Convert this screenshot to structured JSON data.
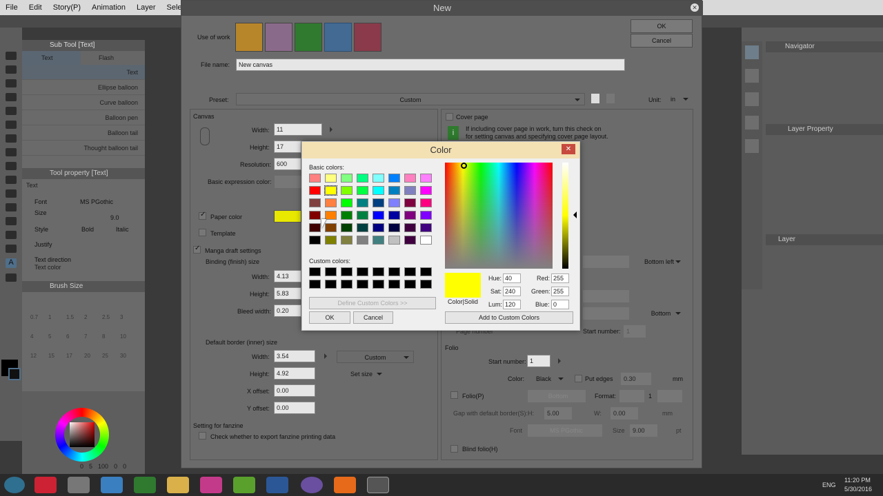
{
  "menubar": [
    "File",
    "Edit",
    "Story(P)",
    "Animation",
    "Layer",
    "Selection"
  ],
  "subtool": {
    "title": "Sub Tool [Text]",
    "tabs": [
      "Text",
      "Flash"
    ],
    "items": [
      "Text",
      "Ellipse balloon",
      "Curve balloon",
      "Balloon pen",
      "Balloon tail",
      "Thought balloon tail"
    ],
    "tool_property_title": "Tool property [Text]",
    "tool_label": "Text",
    "font_label": "Font",
    "font_value": "MS PGothic",
    "size_label": "Size",
    "size_value": "9.0",
    "style_label": "Style",
    "bold": "Bold",
    "italic": "Italic",
    "justify": "Justify",
    "text_direction": "Text direction",
    "text_color": "Text color",
    "brush_size_title": "Brush Size",
    "brush_sizes_row1": [
      "0.7",
      "1",
      "1.5",
      "2",
      "2.5",
      "3"
    ],
    "brush_sizes_row2": [
      "4",
      "5",
      "6",
      "7",
      "8",
      "10"
    ],
    "brush_sizes_row3": [
      "12",
      "15",
      "17",
      "20",
      "25",
      "30"
    ],
    "color_bottom": [
      "0",
      "5",
      "100",
      "0",
      "0"
    ]
  },
  "right_panel": {
    "navigator": "Navigator",
    "layer_property": "Layer Property",
    "layer": "Layer"
  },
  "new_dialog": {
    "title": "New",
    "ok": "OK",
    "cancel": "Cancel",
    "use_of_work": "Use of work",
    "file_name_label": "File name:",
    "file_name_value": "New canvas",
    "preset_label": "Preset:",
    "preset_value": "Custom",
    "unit_label": "Unit:",
    "unit_value": "in",
    "canvas_label": "Canvas",
    "width_label": "Width:",
    "width_value": "11",
    "height_label": "Height:",
    "height_value": "17",
    "resolution_label": "Resolution:",
    "resolution_value": "600",
    "basic_expression_color": "Basic expression color:",
    "paper_color": "Paper color",
    "template": "Template",
    "manga_draft": "Manga draft settings",
    "binding_size": "Binding (finish) size",
    "b_width_value": "4.13",
    "b_height_value": "5.83",
    "bleed_width_label": "Bleed width:",
    "bleed_width_value": "0.20",
    "default_border": "Default border (inner) size",
    "d_width_value": "3.54",
    "d_height_value": "4.92",
    "d_custom": "Custom",
    "set_size": "Set size",
    "x_offset_label": "X offset:",
    "x_offset_value": "0.00",
    "y_offset_label": "Y offset:",
    "y_offset_value": "0.00",
    "fanzine_title": "Setting for fanzine",
    "fanzine_check": "Check whether to export fanzine printing data",
    "cover_page": "Cover page",
    "cover_info_1": "If including cover page in work, turn this check on",
    "cover_info_2": "for setting canvas and specifying cover page layout.",
    "bottom_left": "Bottom left",
    "bottom": "Bottom",
    "page_number": "Page number",
    "start_number_label": "Start number:",
    "start_number_value": "1",
    "folio": "Folio",
    "folio_start_label": "Start number:",
    "folio_start_value": "1",
    "color_label": "Color:",
    "color_value": "Black",
    "put_edges": "Put edges",
    "put_edges_value": "0.30",
    "mm": "mm",
    "folio_p": "Folio(P)",
    "folio_bottom": "Bottom",
    "format_label": "Format:",
    "format_value": "1",
    "gap_label": "Gap with default border(S):",
    "gap_h": "H:",
    "gap_h_value": "5.00",
    "gap_w": "W:",
    "gap_w_value": "0.00",
    "font_label": "Font",
    "font_value": "MS PGothic",
    "size_label": "Size",
    "size_value": "9.00",
    "pt": "pt",
    "blind_folio": "Blind folio(H)"
  },
  "color_dialog": {
    "title": "Color",
    "basic_colors": "Basic colors:",
    "custom_colors": "Custom colors:",
    "define_custom": "Define Custom Colors >>",
    "ok": "OK",
    "cancel": "Cancel",
    "color_solid": "Color|Solid",
    "hue_label": "Hue:",
    "hue": "40",
    "sat_label": "Sat:",
    "sat": "240",
    "lum_label": "Lum:",
    "lum": "120",
    "red_label": "Red:",
    "red": "255",
    "green_label": "Green:",
    "green": "255",
    "blue_label": "Blue:",
    "blue": "0",
    "add_custom": "Add to Custom Colors",
    "selected_color": "#ffff00",
    "basic_swatches": [
      "#ff8080",
      "#ffff80",
      "#80ff80",
      "#00ff80",
      "#80ffff",
      "#0080ff",
      "#ff80c0",
      "#ff80ff",
      "#ff0000",
      "#ffff00",
      "#80ff00",
      "#00ff40",
      "#00ffff",
      "#0080c0",
      "#8080c0",
      "#ff00ff",
      "#804040",
      "#ff8040",
      "#00ff00",
      "#008080",
      "#004080",
      "#8080ff",
      "#800040",
      "#ff0080",
      "#800000",
      "#ff8000",
      "#008000",
      "#008040",
      "#0000ff",
      "#0000a0",
      "#800080",
      "#8000ff",
      "#400000",
      "#804000",
      "#004000",
      "#004040",
      "#000080",
      "#000040",
      "#400040",
      "#400080",
      "#000000",
      "#808000",
      "#808040",
      "#808080",
      "#408080",
      "#c0c0c0",
      "#400040",
      "#ffffff"
    ]
  },
  "taskbar": {
    "lang": "ENG",
    "time": "11:20 PM",
    "date": "5/30/2016"
  }
}
